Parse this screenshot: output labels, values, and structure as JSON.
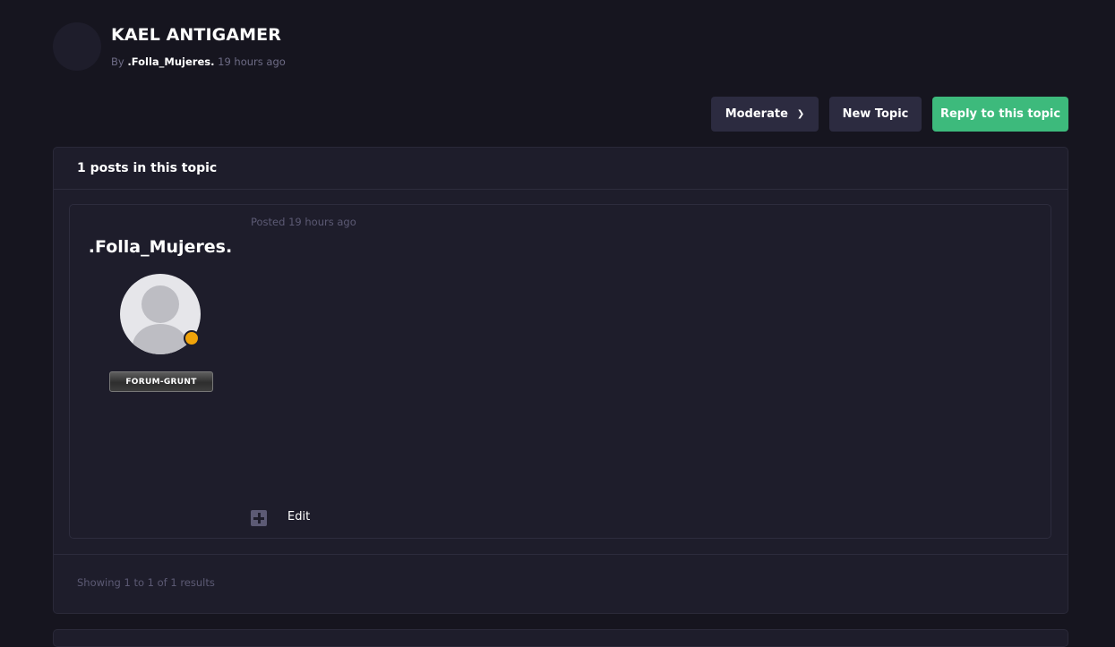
{
  "topic": {
    "title": "KAEL ANTIGAMER",
    "by_label": "By",
    "author": ".Folla_Mujeres.",
    "time": "19 hours ago"
  },
  "actions": {
    "moderate_label": "Moderate",
    "new_topic_label": "New Topic",
    "reply_label": "Reply to this topic"
  },
  "panel": {
    "header": "1 posts in this topic"
  },
  "post": {
    "posted": "Posted 19 hours ago",
    "author": ".Folla_Mujeres.",
    "rank": "FORUM-GRUNT",
    "edit_label": "Edit"
  },
  "footer": {
    "results": "Showing 1 to 1 of 1 results"
  },
  "icons": {
    "moderate_chevron": "chevron-down-icon",
    "multiquote": "plus-icon",
    "avatar": "user-silhouette-icon",
    "online": "status-dot-icon"
  },
  "colors": {
    "background": "#16151f",
    "panel": "#1e1d2b",
    "reply_button": "#3dba7c",
    "secondary_button": "#2c2b40",
    "online_status": "#f0a30a"
  }
}
